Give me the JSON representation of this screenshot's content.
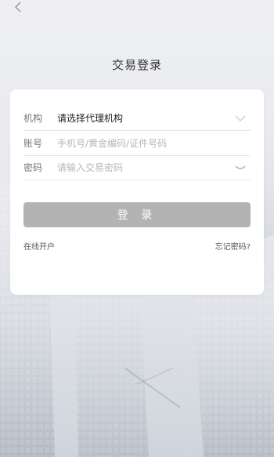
{
  "header": {
    "title": "交易登录"
  },
  "form": {
    "institution": {
      "label": "机构",
      "value": "请选择代理机构"
    },
    "account": {
      "label": "账号",
      "placeholder": "手机号/黄金编码/证件号码"
    },
    "password": {
      "label": "密码",
      "placeholder": "请输入交易密码"
    },
    "login_label": "登 录"
  },
  "links": {
    "open_account": "在线开户",
    "forgot_password": "忘记密码?"
  },
  "colors": {
    "login_button": "#b3b3b3",
    "card": "#ffffff"
  },
  "icons": {
    "back": "chevron-left-icon",
    "dropdown": "chevron-down-icon",
    "password_toggle": "eye-closed-icon"
  }
}
